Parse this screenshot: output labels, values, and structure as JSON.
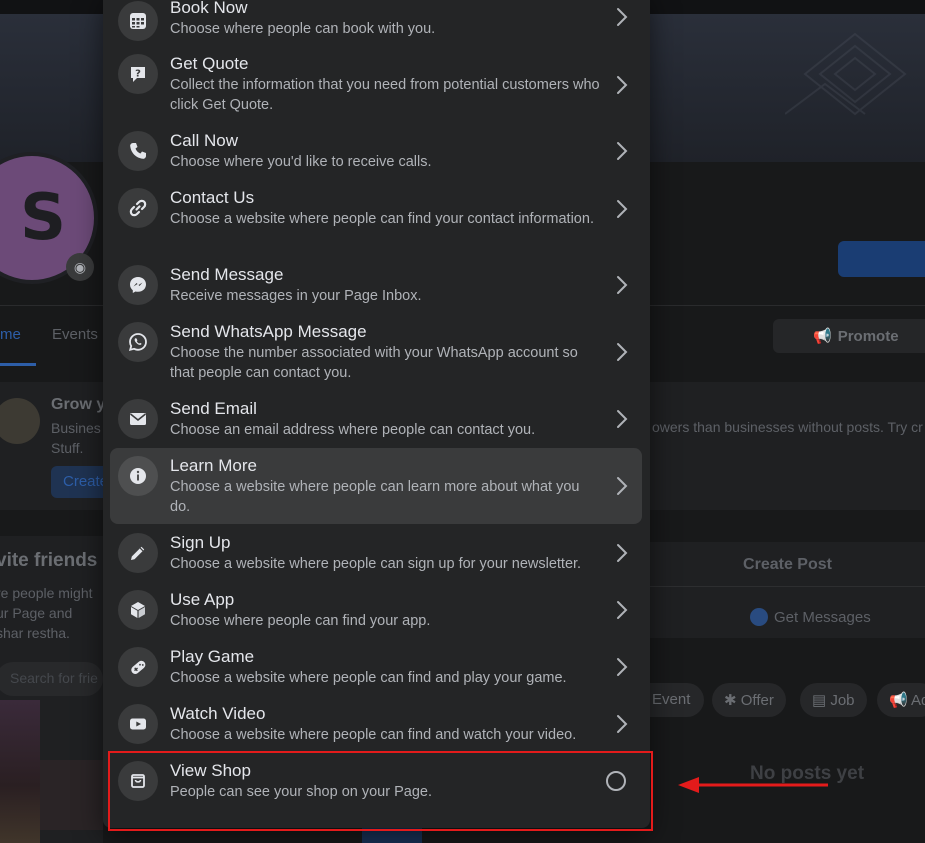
{
  "background": {
    "avatar_letter": "S",
    "nav": {
      "home": "me",
      "events": "Events"
    },
    "promote_label": "Promote",
    "grow_card": {
      "title": "Grow y",
      "text": "Busines Stuff.",
      "text_right": "owers than businesses without posts. Try cr",
      "button": "Create"
    },
    "invite": {
      "title": "vite friends",
      "text": "re people might ur Page and shar restha.",
      "search_placeholder": "Search for frie"
    },
    "create_post": "Create Post",
    "get_messages": "Get Messages",
    "chips": {
      "event": "Event",
      "offer": "Offer",
      "job": "Job",
      "ad": "Ad"
    },
    "no_posts": "No posts yet"
  },
  "menu": {
    "items": [
      {
        "title": "Book Now",
        "desc": "Choose where people can book with you.",
        "icon": "calendar-icon"
      },
      {
        "title": "Get Quote",
        "desc": "Collect the information that you need from potential customers who click Get Quote.",
        "icon": "quote-bubble-icon"
      },
      {
        "title": "Call Now",
        "desc": "Choose where you'd like to receive calls.",
        "icon": "phone-icon"
      },
      {
        "title": "Contact Us",
        "desc": "Choose a website where people can find your contact information.",
        "icon": "link-icon"
      },
      {
        "title": "Send Message",
        "desc": "Receive messages in your Page Inbox.",
        "icon": "messenger-icon"
      },
      {
        "title": "Send WhatsApp Message",
        "desc": "Choose the number associated with your WhatsApp account so that people can contact you.",
        "icon": "whatsapp-icon"
      },
      {
        "title": "Send Email",
        "desc": "Choose an email address where people can contact you.",
        "icon": "envelope-icon"
      },
      {
        "title": "Learn More",
        "desc": "Choose a website where people can learn more about what you do.",
        "icon": "info-icon"
      },
      {
        "title": "Sign Up",
        "desc": "Choose a website where people can sign up for your newsletter.",
        "icon": "pencil-icon"
      },
      {
        "title": "Use App",
        "desc": "Choose where people can find your app.",
        "icon": "cube-icon"
      },
      {
        "title": "Play Game",
        "desc": "Choose a website where people can find and play your game.",
        "icon": "gamepad-icon"
      },
      {
        "title": "Watch Video",
        "desc": "Choose a website where people can find and watch your video.",
        "icon": "play-icon"
      },
      {
        "title": "View Shop",
        "desc": "People can see your shop on your Page.",
        "icon": "shop-bag-icon"
      }
    ],
    "hovered_item": "Learn More",
    "selected_item": "View Shop"
  },
  "annotation": {
    "color": "#e31b1b"
  }
}
